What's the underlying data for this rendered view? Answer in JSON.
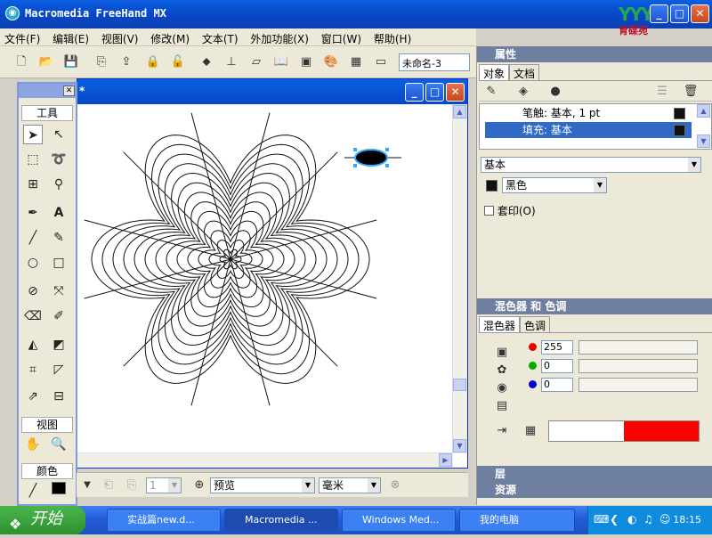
{
  "app": {
    "title": "Macromedia FreeHand MX",
    "brand_text": "育碟苑"
  },
  "menu": [
    "文件(F)",
    "编辑(E)",
    "视图(V)",
    "修改(M)",
    "文本(T)",
    "外加功能(X)",
    "窗口(W)",
    "帮助(H)"
  ],
  "toolbar": {
    "doc_name": "未命名-3"
  },
  "document": {
    "title_suffix": "*"
  },
  "tools_panel": {
    "section_tools": "工具",
    "section_view": "视图",
    "section_color": "颜色"
  },
  "doc_status": {
    "view_mode": "预览",
    "unit": "毫米",
    "page": "1"
  },
  "properties_panel": {
    "title": "属性",
    "tabs": [
      "对象",
      "文档"
    ],
    "rows": [
      {
        "label": "笔触: 基本, 1 pt",
        "selected": false
      },
      {
        "label": "填充: 基本",
        "selected": true
      }
    ],
    "fill_type": "基本",
    "color_name": "黑色",
    "overprint": "套印(O)"
  },
  "mixer_panel": {
    "title": "混色器 和 色调",
    "tabs": [
      "混色器",
      "色调"
    ],
    "r": "255",
    "g": "0",
    "b": "0",
    "preview_colors": [
      "#ffffff",
      "#ff0000"
    ]
  },
  "collapsed_panels": [
    "层",
    "资源"
  ],
  "taskbar": {
    "start": "开始",
    "tasks": [
      "实战篇new.d...",
      "Macromedia ...",
      "Windows Med...",
      "我的电脑"
    ],
    "clock": "18:15"
  },
  "colors": {
    "accent": "#0a5fe0",
    "selection": "#316ac5",
    "red": "#ff0000"
  }
}
